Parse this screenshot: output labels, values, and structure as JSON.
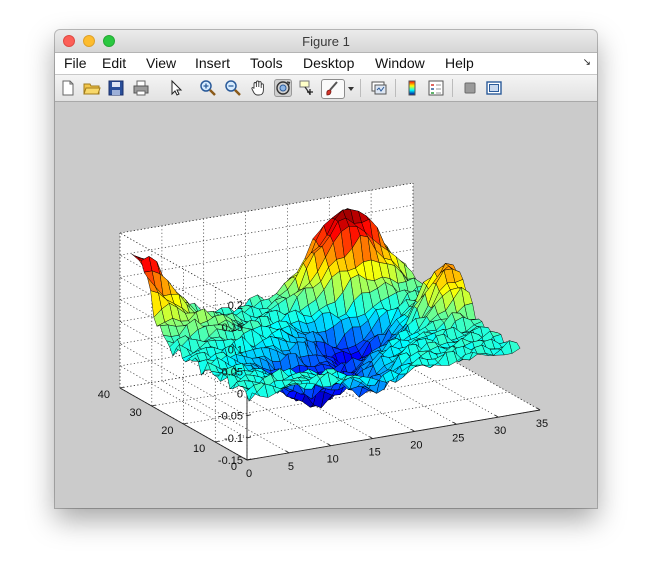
{
  "window": {
    "title": "Figure 1"
  },
  "menubar": {
    "items": [
      {
        "label": "File"
      },
      {
        "label": "Edit"
      },
      {
        "label": "View"
      },
      {
        "label": "Insert"
      },
      {
        "label": "Tools"
      },
      {
        "label": "Desktop"
      },
      {
        "label": "Window"
      },
      {
        "label": "Help"
      }
    ],
    "overflow_icon": "arrow-icon"
  },
  "toolbar": {
    "buttons": [
      "new-figure-icon",
      "open-file-icon",
      "save-icon",
      "print-icon",
      "edit-plot-arrow-icon",
      "zoom-in-icon",
      "zoom-out-icon",
      "pan-hand-icon",
      "rotate-3d-icon",
      "data-cursor-icon",
      "brush-icon",
      "brush-dropdown-icon",
      "link-plot-icon",
      "colorbar-icon",
      "legend-icon",
      "hide-plot-tools-icon",
      "show-plot-tools-icon"
    ]
  },
  "chart_data": {
    "type": "surface-3d",
    "colormap": "jet",
    "x_ticks": [
      "0",
      "5",
      "10",
      "15",
      "20",
      "25",
      "30",
      "35"
    ],
    "y_ticks": [
      "0",
      "10",
      "20",
      "30",
      "40"
    ],
    "z_ticks": [
      "-0.15",
      "-0.1",
      "-0.05",
      "0",
      "0.05",
      "0.1",
      "0.15",
      "0.2"
    ],
    "xlim": [
      0,
      35
    ],
    "ylim": [
      0,
      40
    ],
    "zlim": [
      -0.15,
      0.2
    ],
    "grid": true,
    "accent_colors": [
      "#00008f",
      "#0000ff",
      "#00ffff",
      "#ffff00",
      "#ff0000",
      "#800000"
    ]
  }
}
